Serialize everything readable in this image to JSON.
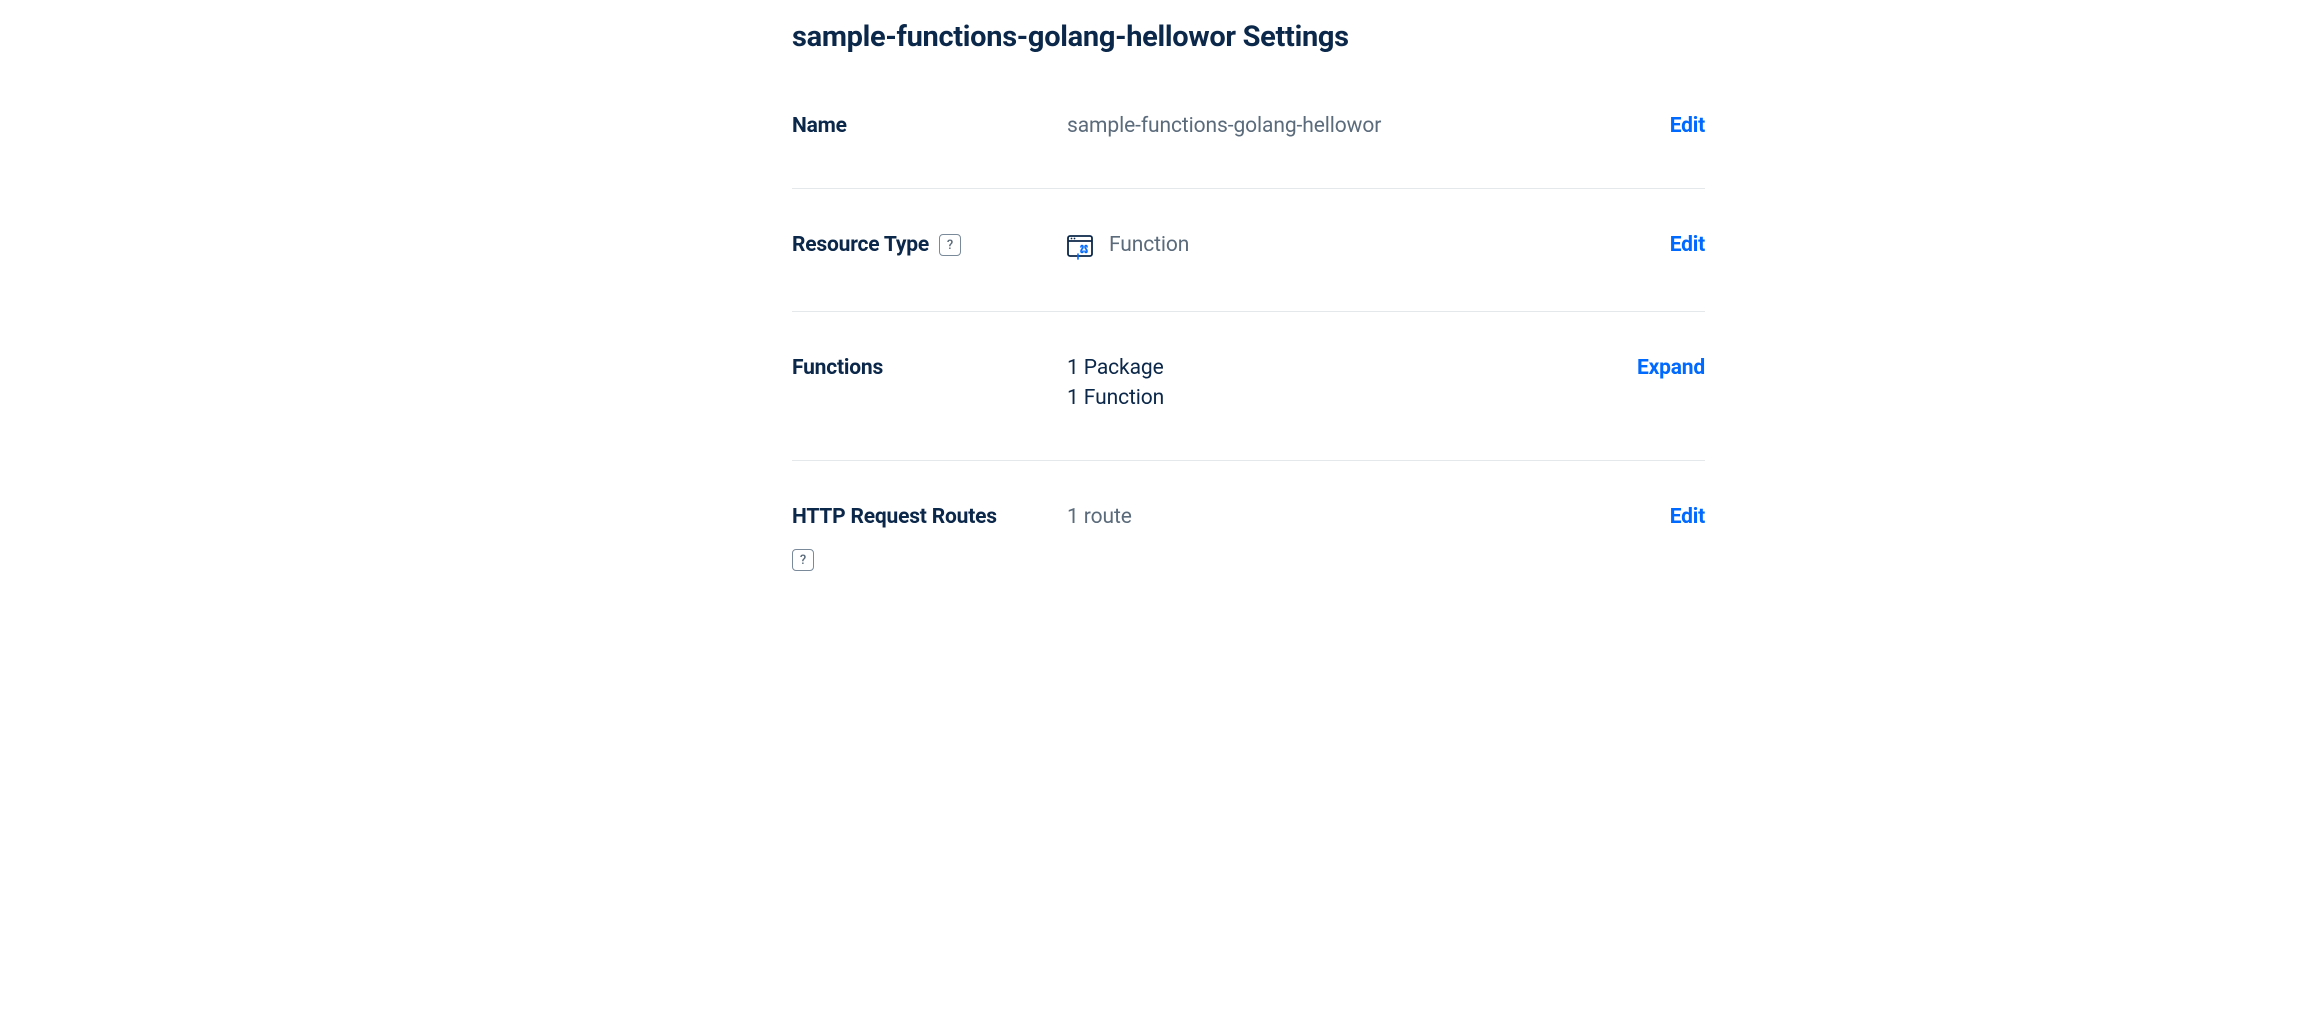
{
  "page": {
    "title": "sample-functions-golang-hellowor Settings"
  },
  "settings": {
    "name": {
      "label": "Name",
      "value": "sample-functions-golang-hellowor",
      "action": "Edit"
    },
    "resourceType": {
      "label": "Resource Type",
      "value": "Function",
      "action": "Edit"
    },
    "functions": {
      "label": "Functions",
      "packages": "1 Package",
      "functionsCount": "1 Function",
      "action": "Expand"
    },
    "httpRoutes": {
      "label": "HTTP Request Routes",
      "value": "1 route",
      "action": "Edit"
    }
  }
}
